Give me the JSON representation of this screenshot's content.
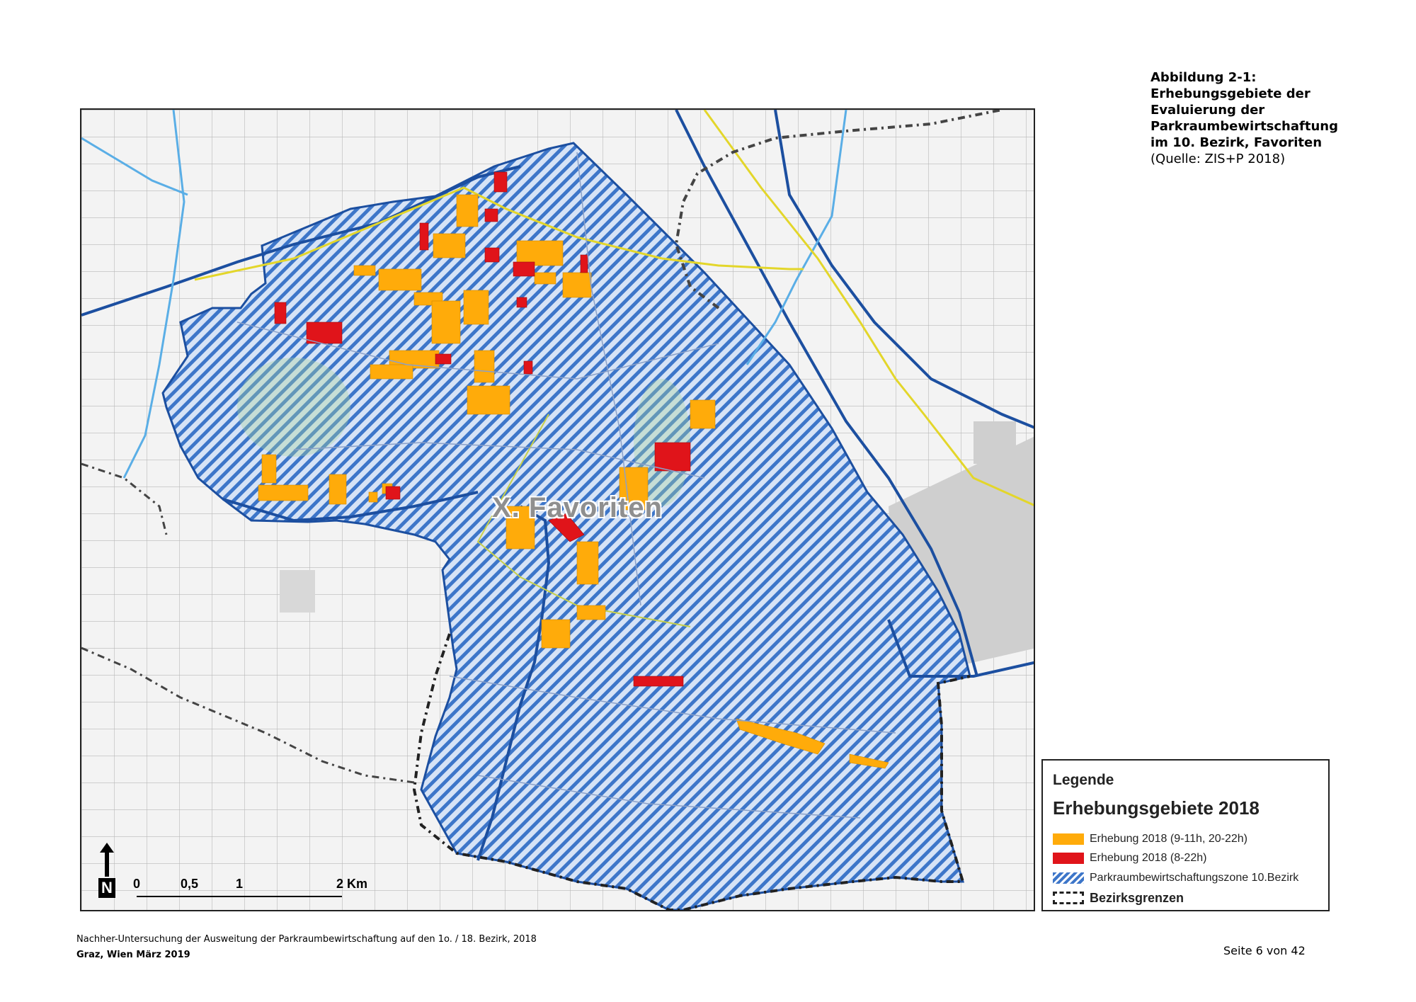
{
  "caption": {
    "line1": "Abbildung 2-1:",
    "line2": "Erhebungsgebiete der",
    "line3": "Evaluierung der",
    "line4": "Parkraumbewirtschaftung",
    "line5": "im 10. Bezirk, Favoriten",
    "source": "(Quelle: ZIS+P 2018)"
  },
  "map": {
    "district_label": "X. Favoriten",
    "colors": {
      "hatch_blue": "#3d76c9",
      "zone_fill": "#c9d9f2",
      "survey_orange": "#ffab0a",
      "survey_red": "#e0141a",
      "road_blue": "#1c4fa0",
      "road_yellow": "#e3d62a",
      "border_dash": "#222222"
    },
    "icons": {
      "north_arrow": "north-arrow-icon"
    }
  },
  "legend": {
    "title": "Legende",
    "subtitle": "Erhebungsgebiete 2018",
    "items": [
      {
        "label": "Erhebung 2018 (9-11h, 20-22h)",
        "color": "#ffab0a"
      },
      {
        "label": "Erhebung 2018 (8-22h)",
        "color": "#e0141a"
      },
      {
        "label": "Parkraumbewirtschaftungszone 10.Bezirk",
        "color": "#3d76c9"
      },
      {
        "label": "Bezirksgrenzen",
        "color": "#222222"
      }
    ]
  },
  "scale_bar": {
    "labels": [
      "0",
      "0,5",
      "1",
      "2 Km"
    ],
    "north_label": "N"
  },
  "footer": {
    "line1": "Nachher-Untersuchung der Ausweitung der Parkraumbewirtschaftung auf den 1o. / 18. Bezirk, 2018",
    "line2": "Graz, Wien März 2019",
    "page": "Seite 6 von 42"
  }
}
